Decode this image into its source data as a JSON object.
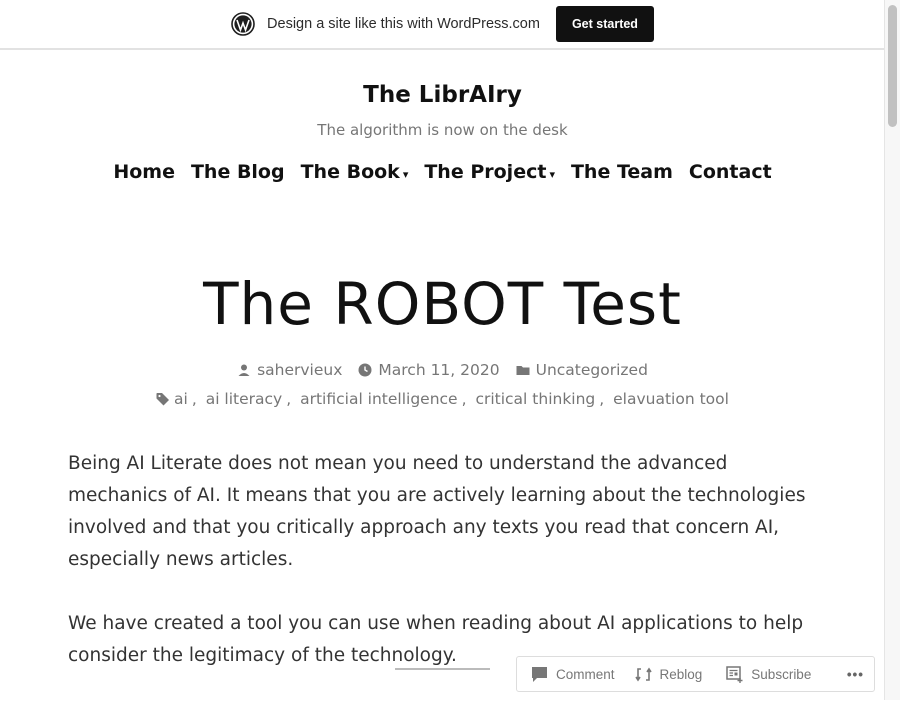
{
  "topbar": {
    "logo_icon": "wordpress-logo-icon",
    "text": "Design a site like this with WordPress.com",
    "cta_label": "Get started"
  },
  "site": {
    "title": "The LibrAIry",
    "tagline": "The algorithm is now on the desk"
  },
  "nav": {
    "items": [
      {
        "label": "Home",
        "has_dropdown": false
      },
      {
        "label": "The Blog",
        "has_dropdown": false
      },
      {
        "label": "The Book",
        "has_dropdown": true
      },
      {
        "label": "The Project",
        "has_dropdown": true
      },
      {
        "label": "The Team",
        "has_dropdown": false
      },
      {
        "label": "Contact",
        "has_dropdown": false
      }
    ],
    "caret": "▾"
  },
  "post": {
    "title": "The ROBOT Test",
    "author": "sahervieux",
    "date": "March 11, 2020",
    "category": "Uncategorized",
    "tags": [
      "ai",
      "ai literacy",
      "artificial intelligence",
      "critical thinking",
      "elavuation tool"
    ],
    "paragraphs": [
      "Being AI Literate does not mean you need to understand the advanced mechanics of AI. It means that you are actively learning about the technologies involved and that you critically approach any texts you read that concern AI, especially news articles.",
      "We have created a tool you can use when reading about AI applications to help consider the legitimacy of the technology."
    ]
  },
  "actionbar": {
    "comment": "Comment",
    "reblog": "Reblog",
    "subscribe": "Subscribe",
    "more": "•••"
  }
}
